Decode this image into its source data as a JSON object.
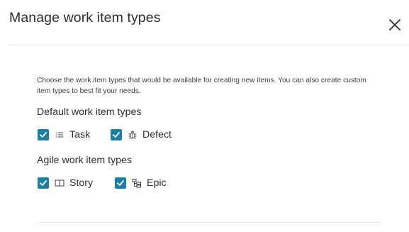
{
  "dialog": {
    "title": "Manage work item types",
    "description": "Choose the work item types that would be available for creating new items. You can also create custom item types to best fit your needs."
  },
  "sections": [
    {
      "title": "Default work item types",
      "options": [
        {
          "label": "Task",
          "checked": true,
          "icon": "task-list-icon"
        },
        {
          "label": "Defect",
          "checked": true,
          "icon": "bug-icon"
        }
      ]
    },
    {
      "title": "Agile work item types",
      "options": [
        {
          "label": "Story",
          "checked": true,
          "icon": "book-icon"
        },
        {
          "label": "Epic",
          "checked": true,
          "icon": "hierarchy-icon"
        }
      ]
    }
  ],
  "colors": {
    "checkbox": "#1b7ea3",
    "divider": "#dfe3e6",
    "text": "#2b2f33"
  }
}
